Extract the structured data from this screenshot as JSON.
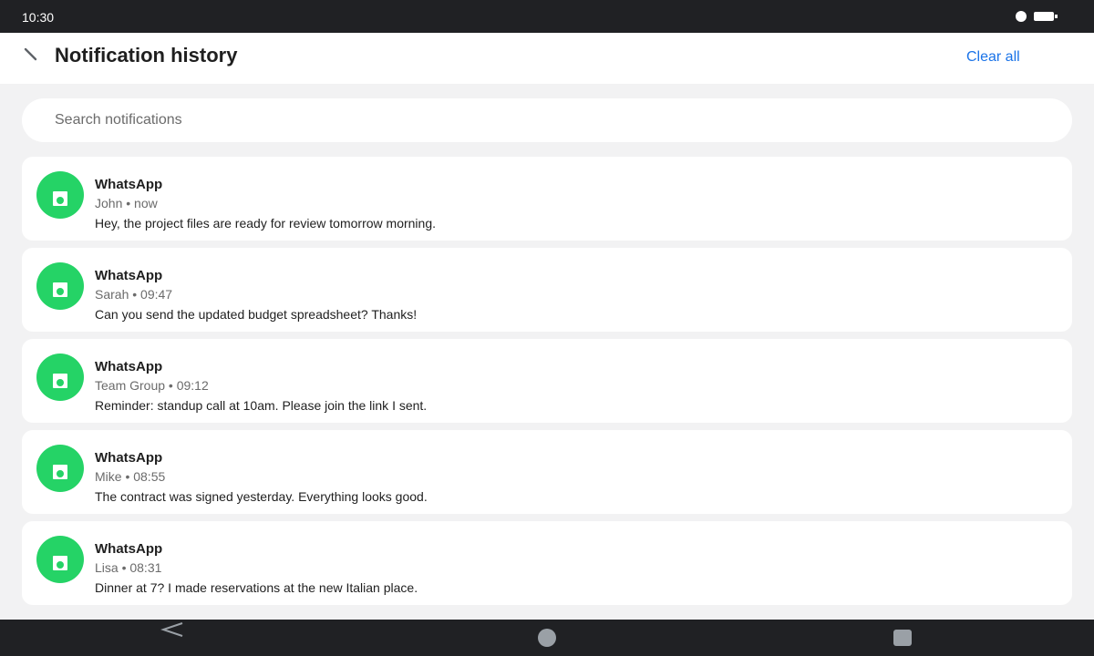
{
  "status_bar": {
    "time": "10:30",
    "icons": [
      "dot-indicator-icon",
      "battery-icon"
    ]
  },
  "header": {
    "title": "Notification history",
    "back_icon": "back-arrow-icon",
    "clear_all_label": "Clear all"
  },
  "search": {
    "placeholder": "Search notifications",
    "value": ""
  },
  "notifications": [
    {
      "app": "WhatsApp",
      "meta": "John • now",
      "message": "Hey, the project files are ready for review tomorrow morning."
    },
    {
      "app": "WhatsApp",
      "meta": "Sarah • 09:47",
      "message": "Can you send the updated budget spreadsheet? Thanks!"
    },
    {
      "app": "WhatsApp",
      "meta": "Team Group • 09:12",
      "message": "Reminder: standup call at 10am. Please join the link I sent."
    },
    {
      "app": "WhatsApp",
      "meta": "Mike • 08:55",
      "message": "The contract was signed yesterday. Everything looks good."
    },
    {
      "app": "WhatsApp",
      "meta": "Lisa • 08:31",
      "message": "Dinner at 7? I made reservations at the new Italian place."
    }
  ],
  "nav_bar": {
    "icons": [
      "nav-back-icon",
      "nav-home-icon",
      "nav-recents-icon"
    ]
  },
  "colors": {
    "accent": "#1a73e8",
    "whatsapp_green": "#25d366",
    "system_bar": "#202124",
    "background": "#f2f2f3"
  }
}
